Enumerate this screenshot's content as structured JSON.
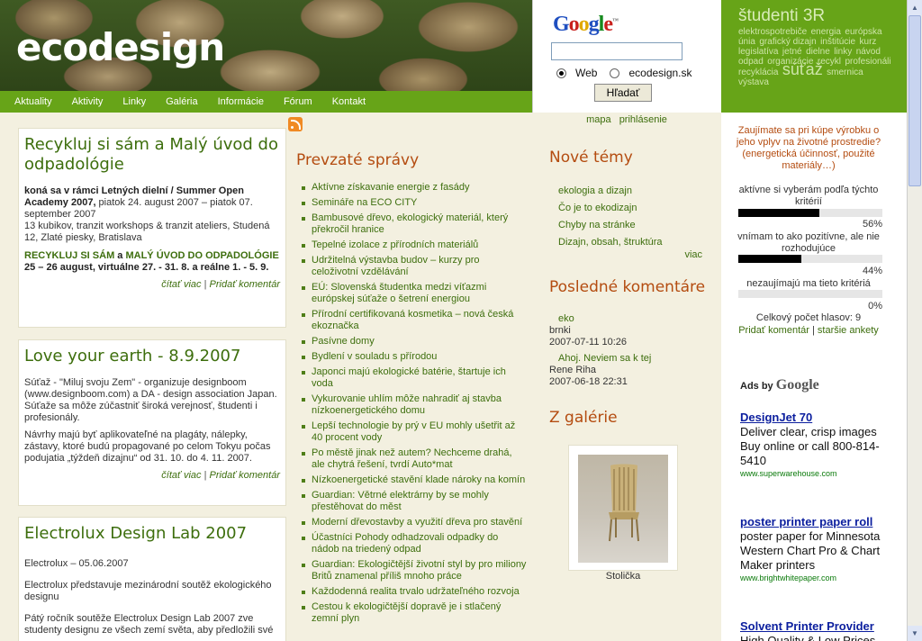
{
  "header": {
    "site_title": "ecodesign"
  },
  "nav": [
    "Aktuality",
    "Aktivity",
    "Linky",
    "Galéria",
    "Informácie",
    "Fórum",
    "Kontakt"
  ],
  "google_search": {
    "logo": "Google",
    "options": [
      "Web",
      "ecodesign.sk"
    ],
    "selected": "Web",
    "button": "Hľadať",
    "query": ""
  },
  "tag_cloud": {
    "heading": "študenti 3R",
    "words": [
      "elektrospotrebiče",
      "energia",
      "európska únia",
      "grafický dizajn",
      "inštitúcie",
      "kurz",
      "legislatíva",
      "jetné",
      "dielne",
      "linky",
      "návod",
      "odpad",
      "organizácie",
      "recykl",
      "profesionáli",
      "recyklácia",
      "súťaž",
      "smernica",
      "výstava"
    ]
  },
  "util_links": [
    "mapa",
    "prihlásenie"
  ],
  "articles": [
    {
      "title": "Recykluj si sám a Malý úvod do odpadológie",
      "lead_bold": "koná sa v rámci Letných dielní / Summer Open Academy 2007,",
      "lead_rest": " piatok 24. august 2007 – piatok 07. september 2007",
      "venue": "13 kubikov, tranzit workshops & tranzit ateliers, Studená 12, Zlaté piesky, Bratislava",
      "highlight_a": "RECYKLUJ SI SÁM",
      "highlight_join": " a ",
      "highlight_b": "MALÝ ÚVOD DO ODPADOLÓGIE",
      "dates": "25 – 26 august, virtuálne 27. - 31. 8. a reálne 1. - 5. 9.",
      "read_more": "čítať viac",
      "add_comment": "Pridať komentár"
    },
    {
      "title": "Love your earth - 8.9.2007",
      "p1": "Súťaž - \"Miluj svoju Zem\" - organizuje designboom (www.designboom.com) a DA - design association Japan. Súťaže sa môže zúčastniť široká verejnosť, študenti i profesionály.",
      "p2": "Návrhy majú byť aplikovateľné na plagáty, nálepky, zástavy, ktoré budú propagované po celom Tokyu počas podujatia „týždeň dizajnu“ od 31. 10. do 4. 11. 2007.",
      "read_more": "čítať viac",
      "add_comment": "Pridať komentár"
    },
    {
      "title": "Electrolux Design Lab 2007",
      "p1": "Electrolux – 05.06.2007",
      "p2": "Electrolux představuje mezinárodní soutěž ekologického designu",
      "p3": "Pátý ročník soutěže Electrolux Design Lab 2007 zve studenty designu ze všech zemí světa, aby předložili své"
    }
  ],
  "news": {
    "heading": "Prevzaté správy",
    "items": [
      "Aktívne získavanie energie z fasády",
      "Semináře na ECO CITY",
      "Bambusové dřevo, ekologický materiál, který překročil hranice",
      "Tepelné izolace z přírodních materiálů",
      "Udržitelná výstavba budov – kurzy pro celoživotní vzdělávání",
      "EÚ: Slovenská študentka medzi víťazmi európskej súťaže o šetrení energiou",
      "Přírodní certifikovaná kosmetika – nová česká ekoznačka",
      "Pasívne domy",
      "Bydlení v souladu s přírodou",
      "Japonci majú ekologické batérie, štartuje ich voda",
      "Vykurovanie uhlím môže nahradiť aj stavba nízkoenergetického domu",
      "Lepší technologie by prý v EU mohly ušetřit až 40 procent vody",
      "Po městě jinak než autem? Nechceme drahá, ale chytrá řešení, tvrdí Auto*mat",
      "Nízkoenergetické stavění klade nároky na komín",
      "Guardian: Větrné elektrárny by se mohly přestěhovat do měst",
      "Moderní dřevostavby a využití dřeva pro stavění",
      "Účastníci Pohody odhadzovali odpadky do nádob na triedený odpad",
      "Guardian: Ekologičtější životní styl by pro miliony Britů znamenal příliš mnoho práce",
      "Každodenná realita trvalo udržateľného rozvoja",
      "Cestou k ekologičtější dopravě je i stlačený zemní plyn"
    ]
  },
  "topics": {
    "heading": "Nové témy",
    "items": [
      "ekologia a dizajn",
      "Čo je to ekodizajn",
      "Chyby na stránke",
      "Dizajn, obsah, štruktúra"
    ],
    "more": "viac"
  },
  "comments": {
    "heading": "Posledné komentáre",
    "items": [
      {
        "title": "eko",
        "author": "brnki",
        "date": "2007-07-11 10:26"
      },
      {
        "title": "Ahoj. Neviem sa k tej",
        "author": "Rene Riha",
        "date": "2007-06-18 22:31"
      }
    ]
  },
  "gallery": {
    "heading": "Z galérie",
    "caption": "Stolička"
  },
  "poll": {
    "question": "Zaujímate sa pri kúpe výrobku o jeho vplyv na životné prostredie? (energetická účinnosť, použité materiály…)",
    "options": [
      {
        "label": "aktívne si vyberám podľa týchto kritérií",
        "percent": 56,
        "pct_text": "56%"
      },
      {
        "label": "vnímam to ako pozitívne, ale nie rozhodujúce",
        "percent": 44,
        "pct_text": "44%"
      },
      {
        "label": "nezaujímajú ma tieto kritériá",
        "percent": 0,
        "pct_text": "0%"
      }
    ],
    "total": "Celkový počet hlasov: 9",
    "add_comment": "Pridať komentár",
    "older": "staršie ankety"
  },
  "ads": {
    "label": "Ads by",
    "brand": "Google",
    "items": [
      {
        "title": "DesignJet 70",
        "text": "Deliver clear, crisp images Buy online or call 800-814-5410",
        "url": "www.superwarehouse.com"
      },
      {
        "title": "poster printer paper roll",
        "text": "poster paper for Minnesota Western Chart Pro & Chart Maker printers",
        "url": "www.brightwhitepaper.com"
      },
      {
        "title": "Solvent Printer Provider",
        "text": "High Quality & Low Prices",
        "url": ""
      }
    ]
  }
}
